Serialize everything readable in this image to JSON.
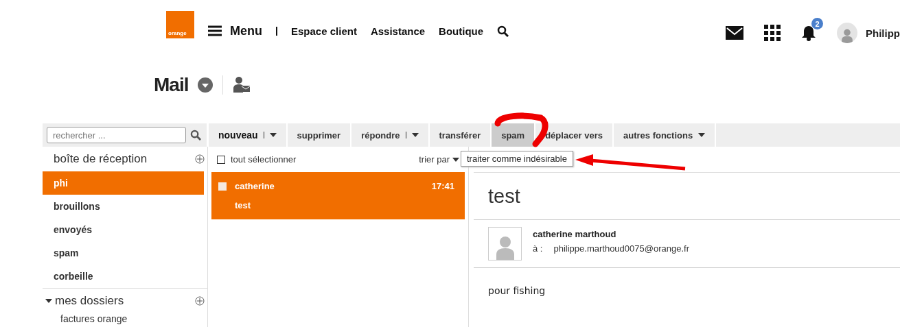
{
  "header": {
    "logo": "orange",
    "nav": [
      {
        "label": "Menu",
        "kind": "menu"
      },
      {
        "label": "Espace client",
        "kind": "link"
      },
      {
        "label": "Assistance",
        "kind": "link"
      },
      {
        "label": "Boutique",
        "kind": "link"
      }
    ],
    "notifications": "2",
    "user": "Philipp"
  },
  "page_title": "Mail",
  "search": {
    "placeholder": "rechercher ..."
  },
  "toolbar": [
    {
      "label": "nouveau",
      "split": true,
      "dropdown": true,
      "selected": false
    },
    {
      "label": "supprimer",
      "split": false,
      "dropdown": false,
      "selected": false
    },
    {
      "label": "répondre",
      "split": true,
      "dropdown": true,
      "selected": false
    },
    {
      "label": "transférer",
      "split": false,
      "dropdown": false,
      "selected": false
    },
    {
      "label": "spam",
      "split": false,
      "dropdown": false,
      "selected": true
    },
    {
      "label": "déplacer vers",
      "split": false,
      "dropdown": false,
      "selected": false
    },
    {
      "label": "autres fonctions",
      "split": false,
      "dropdown": true,
      "selected": false
    }
  ],
  "tooltip": "traiter comme indésirable",
  "sidebar": {
    "inbox": "boîte de réception",
    "folders": [
      {
        "label": "phi",
        "selected": true
      },
      {
        "label": "brouillons",
        "selected": false
      },
      {
        "label": "envoyés",
        "selected": false
      },
      {
        "label": "spam",
        "selected": false
      },
      {
        "label": "corbeille",
        "selected": false
      }
    ],
    "my_folders": {
      "label": "mes dossiers",
      "expanded": true,
      "children": [
        {
          "label": "factures orange"
        }
      ]
    }
  },
  "list": {
    "select_all": "tout sélectionner",
    "select_all_checked": false,
    "sort": "trier par",
    "messages": [
      {
        "sender": "catherine",
        "time": "17:41",
        "subject": "test",
        "checked": false,
        "selected": true
      }
    ]
  },
  "reading": {
    "subject": "test",
    "from": "catherine marthoud",
    "to_label": "à :",
    "to": "philippe.marthoud0075@orange.fr",
    "body": "pour fishing"
  }
}
